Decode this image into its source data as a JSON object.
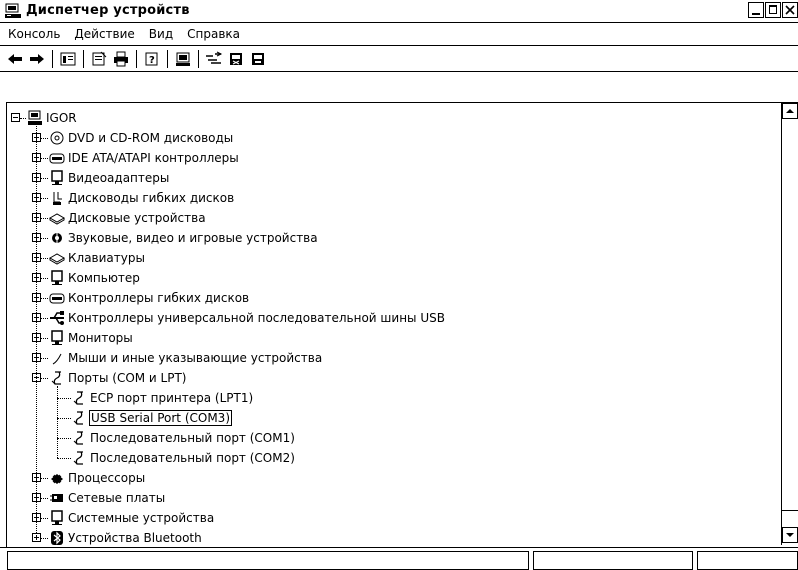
{
  "window": {
    "title": "Диспетчер устройств",
    "icon": "computer-icon",
    "controls": [
      "minimize-icon",
      "maximize-icon",
      "close-icon"
    ]
  },
  "menu": [
    {
      "label": "Консоль"
    },
    {
      "label": "Действие"
    },
    {
      "label": "Вид"
    },
    {
      "label": "Справка"
    }
  ],
  "toolbar": {
    "buttons": [
      "back-arrow-icon",
      "forward-arrow-icon",
      "show-hide-console-tree-icon",
      "properties-icon",
      "print-icon",
      "help-icon",
      "scan-hardware-icon",
      "update-driver-icon",
      "uninstall-icon",
      "disable-icon"
    ]
  },
  "tree": {
    "root": {
      "label": "IGOR",
      "icon": "computer-icon",
      "expanded": true
    },
    "items": [
      {
        "label": "DVD и CD-ROM дисководы",
        "icon": "cdrom-icon",
        "expanded": false
      },
      {
        "label": "IDE ATA/ATAPI контроллеры",
        "icon": "ide-controller-icon",
        "expanded": false
      },
      {
        "label": "Видеоадаптеры",
        "icon": "display-adapter-icon",
        "expanded": false
      },
      {
        "label": "Дисководы гибких дисков",
        "icon": "floppy-drive-icon",
        "expanded": false
      },
      {
        "label": "Дисковые устройства",
        "icon": "disk-drive-icon",
        "expanded": false
      },
      {
        "label": "Звуковые, видео и игровые устройства",
        "icon": "sound-icon",
        "expanded": false
      },
      {
        "label": "Клавиатуры",
        "icon": "keyboard-icon",
        "expanded": false
      },
      {
        "label": "Компьютер",
        "icon": "computer-node-icon",
        "expanded": false
      },
      {
        "label": "Контроллеры гибких дисков",
        "icon": "floppy-controller-icon",
        "expanded": false
      },
      {
        "label": "Контроллеры универсальной последовательной шины USB",
        "icon": "usb-icon",
        "expanded": false
      },
      {
        "label": "Мониторы",
        "icon": "monitor-icon",
        "expanded": false
      },
      {
        "label": "Мыши и иные указывающие устройства",
        "icon": "mouse-icon",
        "expanded": false
      },
      {
        "label": "Порты (COM и LPT)",
        "icon": "port-icon",
        "expanded": true,
        "children": [
          {
            "label": "ECP порт принтера (LPT1)",
            "icon": "port-icon",
            "selected": false
          },
          {
            "label": "USB Serial Port (COM3)",
            "icon": "port-icon",
            "selected": true
          },
          {
            "label": "Последовательный порт (COM1)",
            "icon": "port-icon",
            "selected": false
          },
          {
            "label": "Последовательный порт (COM2)",
            "icon": "port-icon",
            "selected": false
          }
        ]
      },
      {
        "label": "Процессоры",
        "icon": "processor-icon",
        "expanded": false
      },
      {
        "label": "Сетевые платы",
        "icon": "network-adapter-icon",
        "expanded": false
      },
      {
        "label": "Системные устройства",
        "icon": "system-device-icon",
        "expanded": false
      },
      {
        "label": "Устройства Bluetooth",
        "icon": "bluetooth-icon",
        "expanded": false
      }
    ]
  },
  "scrollbar": {
    "up": "scroll-up-arrow-icon",
    "down": "scroll-down-arrow-icon"
  },
  "statusbar": {
    "panels": [
      "",
      "",
      ""
    ]
  }
}
